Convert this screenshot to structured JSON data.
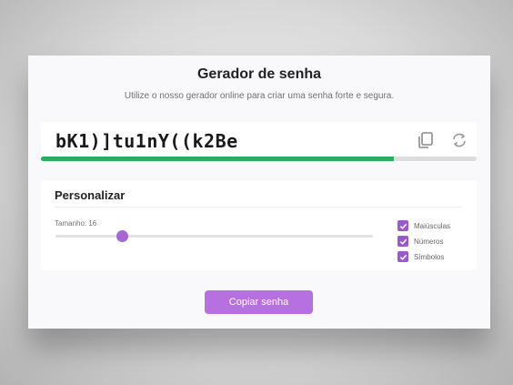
{
  "header": {
    "title": "Gerador de senha",
    "subtitle": "Utilize o nosso gerador online para criar uma senha forte e segura."
  },
  "password": {
    "value": "bK1)]tu1nY((k2Be",
    "strength_fraction": 0.81,
    "strength_color": "#27ae60",
    "copy_icon": "copy-icon",
    "refresh_icon": "refresh-icon"
  },
  "customize": {
    "title": "Personalizar",
    "size_label": "Tamanho: 16",
    "size_slider_fraction": 0.21,
    "options": [
      {
        "label": "Maiúsculas",
        "checked": true
      },
      {
        "label": "Números",
        "checked": true
      },
      {
        "label": "Símbolos",
        "checked": true
      }
    ]
  },
  "actions": {
    "copy_label": "Copiar senha"
  },
  "colors": {
    "accent": "#b770e0",
    "checkbox": "#9b59d0",
    "strength": "#27ae60"
  }
}
